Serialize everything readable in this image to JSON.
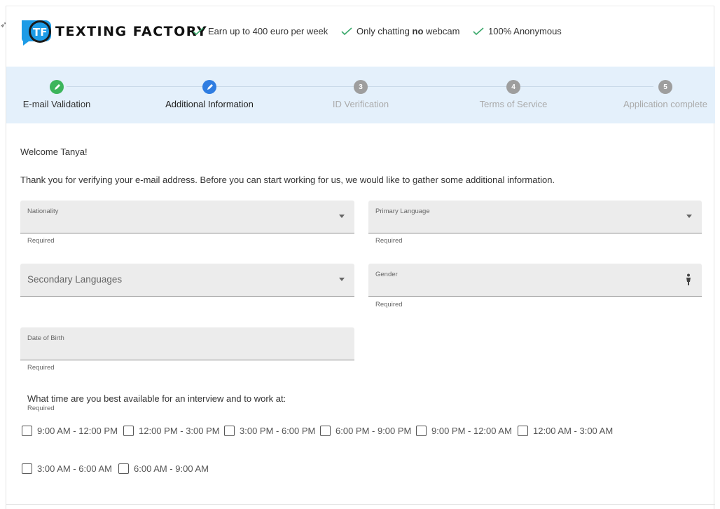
{
  "header": {
    "logo_text": "TF",
    "brand": "TEXTING FACTORY",
    "perks": [
      {
        "before": "Earn up to 400 euro per week",
        "bold": "",
        "after": ""
      },
      {
        "before": "Only chatting ",
        "bold": "no",
        "after": " webcam"
      },
      {
        "before": "100% Anonymous",
        "bold": "",
        "after": ""
      }
    ],
    "check_color": "#3aa86b"
  },
  "stepper": {
    "steps": [
      {
        "label": "E-mail Validation",
        "number": "",
        "state": "done",
        "color": "#3cb55b"
      },
      {
        "label": "Additional Information",
        "number": "",
        "state": "active",
        "color": "#2f7de1"
      },
      {
        "label": "ID Verification",
        "number": "3",
        "state": "pending",
        "color": "#9e9e9e"
      },
      {
        "label": "Terms of Service",
        "number": "4",
        "state": "pending",
        "color": "#9e9e9e"
      },
      {
        "label": "Application complete",
        "number": "5",
        "state": "pending",
        "color": "#9e9e9e"
      }
    ]
  },
  "content": {
    "welcome": "Welcome Tanya!",
    "intro": "Thank you for verifying your e-mail address. Before you can start working for us, we would like to gather some additional information.",
    "fields": {
      "nationality": {
        "label": "Nationality",
        "hint": "Required"
      },
      "primary_language": {
        "label": "Primary Language",
        "hint": "Required"
      },
      "secondary_languages": {
        "placeholder": "Secondary Languages"
      },
      "gender": {
        "label": "Gender",
        "hint": "Required"
      },
      "date_of_birth": {
        "label": "Date of Birth",
        "hint": "Required"
      }
    },
    "availability": {
      "question": "What time are you best available for an interview and to work at:",
      "hint": "Required",
      "slots": [
        "9:00 AM - 12:00 PM",
        "12:00 PM - 3:00 PM",
        "3:00 PM - 6:00 PM",
        "6:00 PM - 9:00 PM",
        "9:00 PM - 12:00 AM",
        "12:00 AM - 3:00 AM",
        "3:00 AM - 6:00 AM",
        "6:00 AM - 9:00 AM"
      ]
    }
  }
}
